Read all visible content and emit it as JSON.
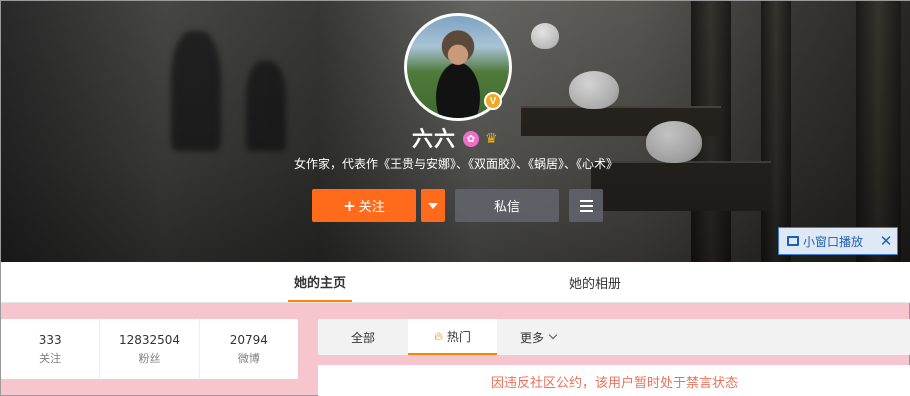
{
  "profile": {
    "name": "六六",
    "bio": "女作家，代表作《王贵与安娜》、《双面胶》、《蜗居》、《心术》",
    "verified_mark": "V"
  },
  "actions": {
    "follow_label": "关注",
    "follow_plus": "+",
    "message_label": "私信"
  },
  "pip": {
    "label": "小窗口播放",
    "close": "✕"
  },
  "nav": {
    "tabs": [
      {
        "label": "她的主页",
        "active": true
      },
      {
        "label": "她的相册",
        "active": false
      }
    ]
  },
  "stats": [
    {
      "value": "333",
      "label": "关注"
    },
    {
      "value": "12832504",
      "label": "粉丝"
    },
    {
      "value": "20794",
      "label": "微博"
    }
  ],
  "feed_tabs": {
    "all": "全部",
    "hot": "热门",
    "more": "更多"
  },
  "notice": "因违反社区公约，该用户暂时处于禁言状态",
  "colors": {
    "accent": "#ff8200",
    "follow_button": "#ff6b1a",
    "notice_text": "#e9715a",
    "page_background": "#f7c5ce"
  },
  "icons": [
    "plus-icon",
    "dropdown-arrow-icon",
    "menu-icon",
    "pip-window-icon",
    "close-icon",
    "fire-icon",
    "chevron-down-icon",
    "verified-icon",
    "badge-icon",
    "vip-crown-icon"
  ]
}
